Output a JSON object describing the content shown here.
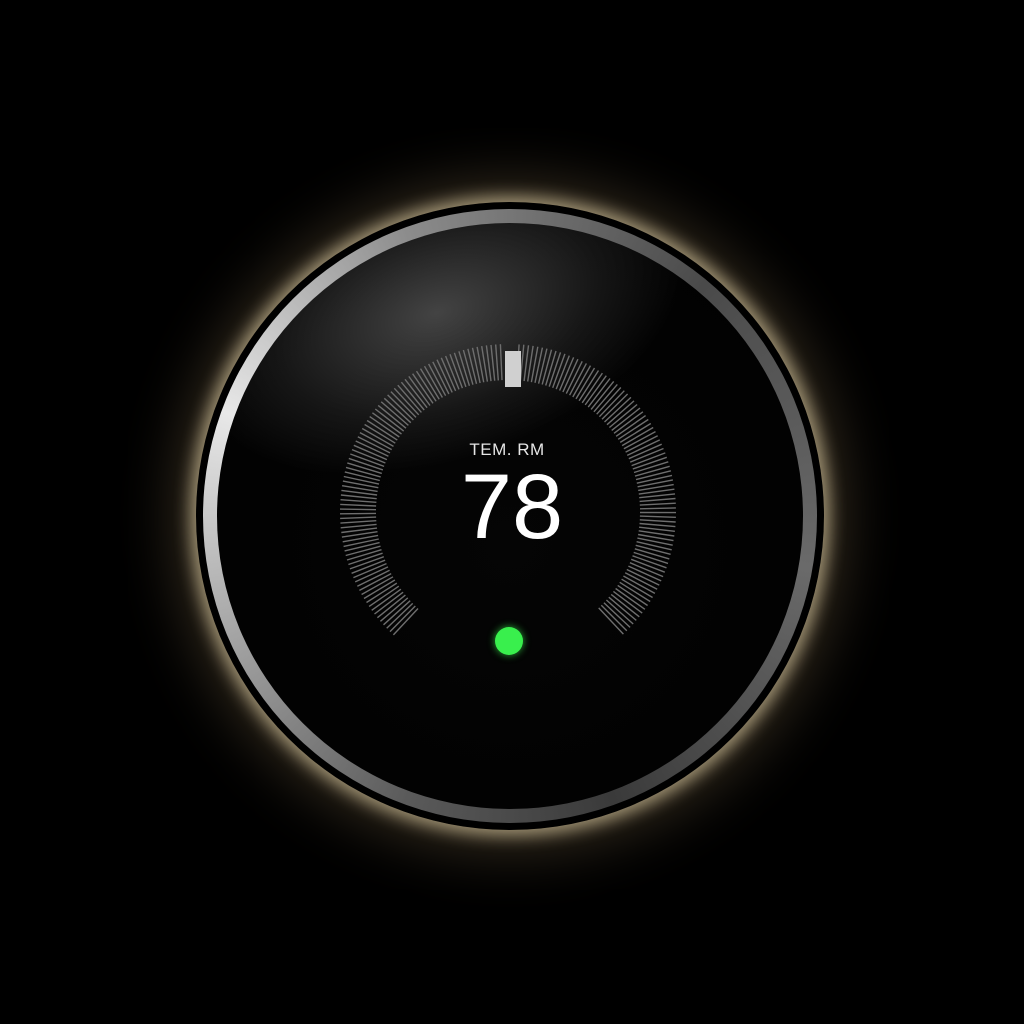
{
  "thermostat": {
    "mode_label": "TEM. RM",
    "temperature": "78",
    "status_icon": "status-dot-icon",
    "status_color": "#39ef4d",
    "glow_color": "#ffe9b8"
  }
}
